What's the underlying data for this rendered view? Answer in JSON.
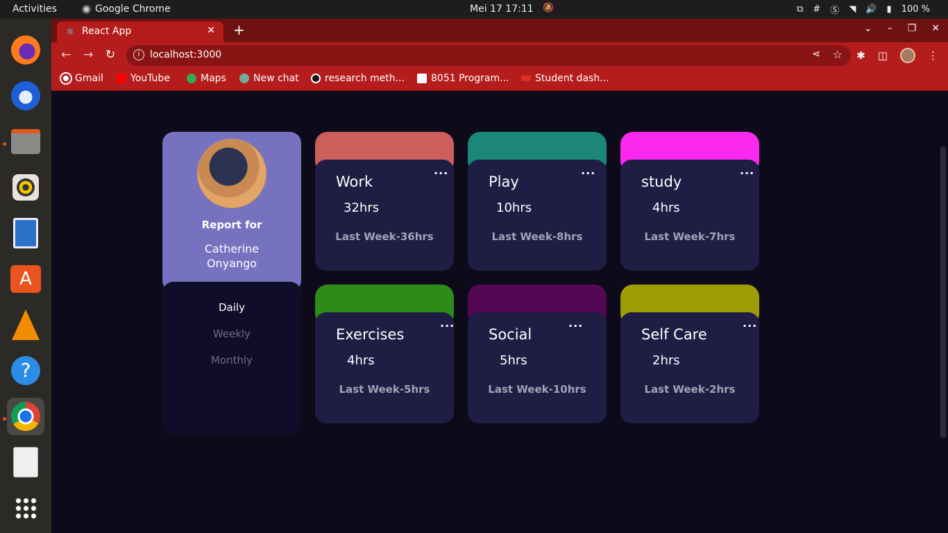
{
  "system": {
    "activities": "Activities",
    "app_name": "Google Chrome",
    "clock": "Mei 17  17:11",
    "battery": "100 %"
  },
  "browser": {
    "tab_title": "React App",
    "url": "localhost:3000",
    "bookmarks": [
      "Gmail",
      "YouTube",
      "Maps",
      "New chat",
      "research meth...",
      "8051 Program...",
      "Student dash..."
    ]
  },
  "profile": {
    "report_for": "Report for",
    "name_line1": "Catherine",
    "name_line2": "Onyango",
    "periods": [
      {
        "label": "Daily",
        "active": true
      },
      {
        "label": "Weekly",
        "active": false
      },
      {
        "label": "Monthly",
        "active": false
      }
    ]
  },
  "cards": [
    {
      "title": "Work",
      "hours": "32hrs",
      "last": "Last Week-36hrs",
      "color": "#cc5e5c"
    },
    {
      "title": "Play",
      "hours": "10hrs",
      "last": "Last Week-8hrs",
      "color": "#1a8778"
    },
    {
      "title": "study",
      "hours": "4hrs",
      "last": "Last Week-7hrs",
      "color": "#fb28f0"
    },
    {
      "title": "Exercises",
      "hours": "4hrs",
      "last": "Last Week-5hrs",
      "color": "#2e8b1a"
    },
    {
      "title": "Social",
      "hours": "5hrs",
      "last": "Last Week-10hrs",
      "color": "#540854"
    },
    {
      "title": "Self Care",
      "hours": "2hrs",
      "last": "Last Week-2hrs",
      "color": "#9e9d08"
    }
  ],
  "more_symbol": "···",
  "dock_apps": [
    "firefox-icon",
    "thunderbird-icon",
    "files-icon",
    "rhythmbox-icon",
    "writer-icon",
    "software-center-icon",
    "vlc-icon",
    "help-icon",
    "chrome-icon",
    "document-viewer-icon",
    "app-grid-icon"
  ]
}
